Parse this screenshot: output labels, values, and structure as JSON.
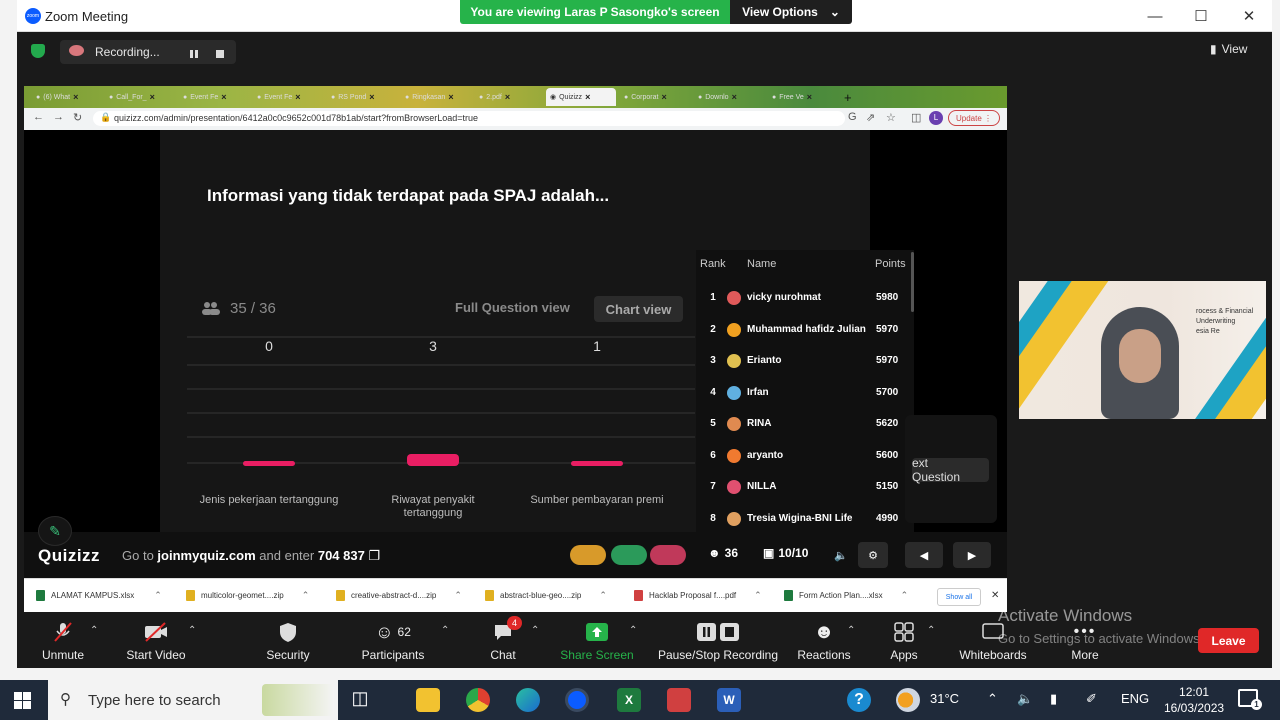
{
  "window": {
    "title": "Zoom Meeting",
    "banner_text": "You are viewing Laras P Sasongko's screen",
    "view_options": "View Options"
  },
  "zoom_top": {
    "recording": "Recording...",
    "view": "View"
  },
  "browser": {
    "tabs": [
      "(6) What",
      "Call_For_",
      "Event Fe",
      "Event Fe",
      "RS Pond",
      "Ringkasan",
      "2.pdf",
      "Quizizz",
      "Corporat",
      "Downlo",
      "Free Ve"
    ],
    "url": "quizizz.com/admin/presentation/6412a0c0c9652c001d78b1ab/start?fromBrowserLoad=true",
    "update_label": "Update"
  },
  "quiz": {
    "question": "Informasi yang tidak terdapat pada SPAJ adalah...",
    "answered": "35 / 36",
    "full_question_view": "Full Question view",
    "chart_view": "Chart view",
    "next_question": "ext Question"
  },
  "chart_data": {
    "type": "bar",
    "categories": [
      "Jenis pekerjaan tertanggung",
      "Riwayat penyakit tertanggung",
      "Sumber pembayaran premi"
    ],
    "values": [
      0,
      3,
      1
    ],
    "ylim": [
      0,
      36
    ],
    "grid": true
  },
  "leaderboard": {
    "headers": {
      "rank": "Rank",
      "name": "Name",
      "points": "Points"
    },
    "rows": [
      {
        "rank": "1",
        "name": "vicky nurohmat",
        "points": "5980",
        "color": "#e05a5a"
      },
      {
        "rank": "2",
        "name": "Muhammad hafidz Julian",
        "points": "5970",
        "color": "#f0a020"
      },
      {
        "rank": "3",
        "name": "Erianto",
        "points": "5970",
        "color": "#e0c050"
      },
      {
        "rank": "4",
        "name": "Irfan",
        "points": "5700",
        "color": "#60b0e0"
      },
      {
        "rank": "5",
        "name": "RINA",
        "points": "5620",
        "color": "#e08a50"
      },
      {
        "rank": "6",
        "name": "aryanto",
        "points": "5600",
        "color": "#f07a30"
      },
      {
        "rank": "7",
        "name": "NILLA",
        "points": "5150",
        "color": "#e05070"
      },
      {
        "rank": "8",
        "name": "Tresia Wigina-BNI Life",
        "points": "4990",
        "color": "#e0a060"
      }
    ]
  },
  "quiz_bar": {
    "logo": "Quizizz",
    "goto_prefix": "Go to",
    "site": "joinmyquiz.com",
    "goto_mid": "and enter",
    "code": "704 837",
    "participants": "36",
    "progress": "10/10"
  },
  "downloads": {
    "items": [
      "ALAMAT KAMPUS.xlsx",
      "multicolor-geomet....zip",
      "creative-abstract-d....zip",
      "abstract-blue-geo....zip",
      "Hacklab Proposal f....pdf",
      "Form Action Plan....xlsx"
    ],
    "show_all": "Show all"
  },
  "video": {
    "line1": "rocess & Financial Underwriting",
    "line2": "esia Re"
  },
  "toolbar": {
    "unmute": "Unmute",
    "start_video": "Start Video",
    "security": "Security",
    "participants": "Participants",
    "participants_count": "62",
    "chat": "Chat",
    "chat_badge": "4",
    "share_screen": "Share Screen",
    "pause_stop": "Pause/Stop Recording",
    "reactions": "Reactions",
    "apps": "Apps",
    "whiteboards": "Whiteboards",
    "more": "More",
    "leave": "Leave"
  },
  "watermark": {
    "line1": "Activate Windows",
    "line2": "Go to Settings to activate Windows."
  },
  "taskbar": {
    "search_placeholder": "Type here to search",
    "temperature": "31°C",
    "language": "ENG",
    "time": "12:01",
    "date": "16/03/2023",
    "notifications": "1"
  },
  "colors": {
    "zoom_green": "#26b34a",
    "bar_pink": "#e91e63",
    "leave_red": "#e02828"
  }
}
